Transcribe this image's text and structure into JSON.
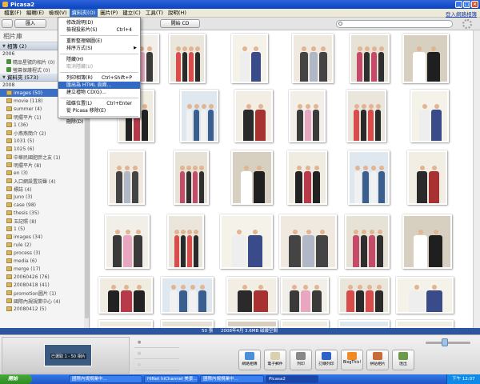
{
  "window": {
    "title": "Picasa2",
    "buttons": [
      "_",
      "□",
      "×"
    ]
  },
  "menubar": {
    "items": [
      "檔案(F)",
      "編輯(E)",
      "檢視(V)",
      "資料夾(O)",
      "圖片(P)",
      "建立(C)",
      "工具(T)",
      "說明(H)"
    ],
    "active_index": 3,
    "right_link": "登入網路相簿"
  },
  "toolbar": {
    "import_label": "匯入",
    "upload_label": "開始 CD",
    "search_placeholder": ""
  },
  "library": {
    "title": "相片庫",
    "sections": [
      {
        "label": "相簿 (2)",
        "year": "2006",
        "items": [
          "精品星號的相片 (0)",
          "螢幕保護程式 (0)"
        ]
      },
      {
        "label": "資料夾 (573)",
        "year": "2008"
      }
    ],
    "folders": [
      "images (50)",
      "movie (118)",
      "summer (4)",
      "明擺平片 (1)",
      "1 (36)",
      "小燕燕簡介 (2)",
      "1031 (5)",
      "1025 (6)",
      "中華民國肥胖之友 (1)",
      "明擺平片 (8)",
      "en (3)",
      "入口網設置説聲 (4)",
      "標誌 (4)",
      "Juno (3)",
      "case (98)",
      "thesis (35)",
      "玉記照 (8)",
      "1 (5)",
      "images (34)",
      "rule (2)",
      "process (3)",
      "media (6)",
      "merge (17)",
      "20060426 (76)",
      "20080418 (41)",
      "promotion圖片 (1)",
      "國際內規規業中心 (4)",
      "20080412 (5)"
    ],
    "selected_index": 0
  },
  "dropdown": {
    "items": [
      {
        "label": "修改說明(D)",
        "shortcut": ""
      },
      {
        "label": "檢視投影片(S)",
        "shortcut": "Ctrl+4"
      },
      {
        "sep": true
      },
      {
        "label": "重新整理縮圖(E)",
        "shortcut": ""
      },
      {
        "label": "排序方式(S)",
        "shortcut": "",
        "submenu": true
      },
      {
        "sep": true
      },
      {
        "label": "隱藏(H)",
        "shortcut": ""
      },
      {
        "label": "取消隱藏(U)",
        "shortcut": "",
        "disabled": true
      },
      {
        "sep": true
      },
      {
        "label": "列印相簿(R)",
        "shortcut": "Ctrl+Shift+P"
      },
      {
        "label": "匯出為 HTML 頁面...",
        "shortcut": "",
        "highlighted": true
      },
      {
        "label": "建立禮物 CD(G)...",
        "shortcut": ""
      },
      {
        "sep": true
      },
      {
        "label": "磁碟位置(L)",
        "shortcut": "Ctrl+Enter"
      },
      {
        "label": "從 Picasa 移除(E)",
        "shortcut": ""
      },
      {
        "sep": true
      },
      {
        "label": "刪除(D)",
        "shortcut": ""
      }
    ]
  },
  "status": {
    "count": "50 張",
    "date": "2008年4月",
    "size": "3.6MB 磁碟空間"
  },
  "tray": {
    "label": "已選取 1 - 50 相片"
  },
  "actions": [
    "網路相簿",
    "電子郵件",
    "列印",
    "訂購列印",
    "BlogThis!",
    "拼貼相片",
    "匯出"
  ],
  "taskbar": {
    "start": "開始",
    "tasks": [
      "國際內規規業中...",
      "HiNet hiChannel 美景...",
      "國際內規規業中...",
      "Picasa2"
    ],
    "clock": "下午 12:07"
  }
}
